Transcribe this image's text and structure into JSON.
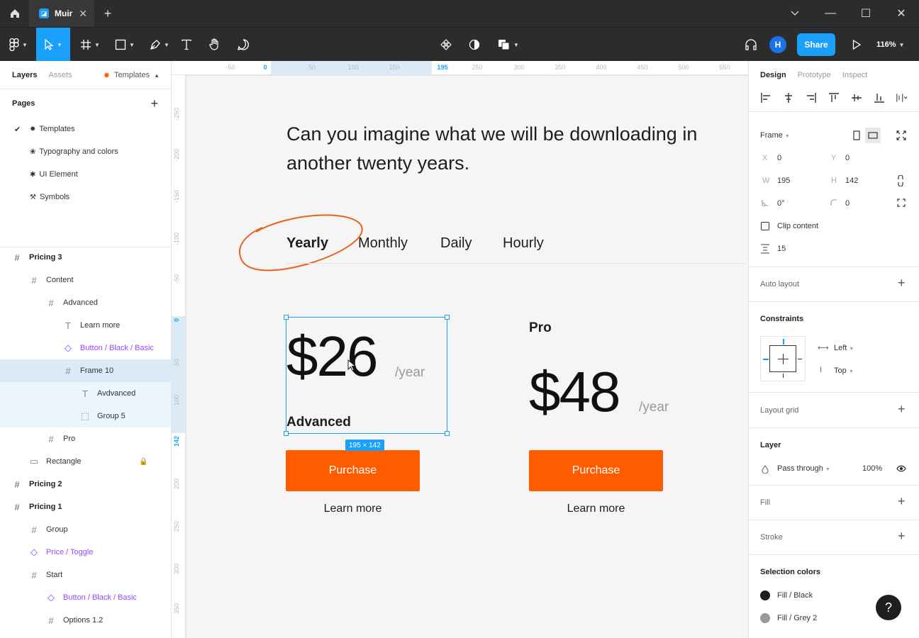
{
  "window": {
    "tab_name": "Muir",
    "minimize": "—",
    "maximize": "☐",
    "close": "✕"
  },
  "toolbar": {
    "avatar_initial": "H",
    "share_label": "Share",
    "zoom_label": "116%"
  },
  "left_panel": {
    "tabs": [
      "Layers",
      "Assets"
    ],
    "templates_label": "Templates",
    "pages_title": "Pages",
    "pages": [
      {
        "label": "Templates",
        "emoji": "✸",
        "current": true
      },
      {
        "label": "Typography and colors",
        "emoji": "❀",
        "current": false
      },
      {
        "label": "UI Element",
        "emoji": "✱",
        "current": false
      },
      {
        "label": "Symbols",
        "emoji": "⚒",
        "current": false
      }
    ],
    "layers": [
      {
        "label": "Pricing 3",
        "indent": 0,
        "type": "frame",
        "bold": true
      },
      {
        "label": "Content",
        "indent": 1,
        "type": "frame"
      },
      {
        "label": "Advanced",
        "indent": 2,
        "type": "frame"
      },
      {
        "label": "Learn more",
        "indent": 3,
        "type": "text"
      },
      {
        "label": "Button / Black / Basic",
        "indent": 3,
        "type": "component"
      },
      {
        "label": "Frame 10",
        "indent": 3,
        "type": "frame",
        "selected": true
      },
      {
        "label": "Avdvanced",
        "indent": 4,
        "type": "text",
        "subselected": true
      },
      {
        "label": "Group 5",
        "indent": 4,
        "type": "group",
        "subselected": true
      },
      {
        "label": "Pro",
        "indent": 2,
        "type": "frame"
      },
      {
        "label": "Rectangle",
        "indent": 1,
        "type": "rect",
        "locked": true
      },
      {
        "label": "Pricing 2",
        "indent": 0,
        "type": "frame",
        "bold": true
      },
      {
        "label": "Pricing 1",
        "indent": 0,
        "type": "frame",
        "bold": true
      },
      {
        "label": "Group",
        "indent": 1,
        "type": "frame"
      },
      {
        "label": "Price / Toggle",
        "indent": 1,
        "type": "component"
      },
      {
        "label": "Start",
        "indent": 1,
        "type": "frame"
      },
      {
        "label": "Button / Black / Basic",
        "indent": 2,
        "type": "component"
      },
      {
        "label": "Options 1.2",
        "indent": 2,
        "type": "frame"
      }
    ]
  },
  "rulers": {
    "top": [
      "-50",
      "0",
      "50",
      "100",
      "150",
      "195",
      "250",
      "300",
      "350",
      "400",
      "450",
      "500",
      "550"
    ],
    "left": [
      "-250",
      "-200",
      "-150",
      "-100",
      "-50",
      "0",
      "50",
      "100",
      "142",
      "200",
      "250",
      "300",
      "350"
    ]
  },
  "canvas": {
    "headline": "Can you imagine what we will be downloading in another twenty years.",
    "period_tabs": [
      "Yearly",
      "Monthly",
      "Daily",
      "Hourly"
    ],
    "cards": [
      {
        "plan": "Advanced",
        "price": "$26",
        "per": "/year",
        "button": "Purchase",
        "link": "Learn more"
      },
      {
        "plan": "Pro",
        "price": "$48",
        "per": "/year",
        "button": "Purchase",
        "link": "Learn more"
      }
    ],
    "selection_size": "195 × 142",
    "accent": "#ff5c00",
    "selection_color": "#18a0fb"
  },
  "right_panel": {
    "tabs": [
      "Design",
      "Prototype",
      "Inspect"
    ],
    "frame_label": "Frame",
    "x_label": "X",
    "x_value": "0",
    "y_label": "Y",
    "y_value": "0",
    "w_label": "W",
    "w_value": "195",
    "h_label": "H",
    "h_value": "142",
    "rotation": "0°",
    "radius": "0",
    "clip_content": "Clip content",
    "spacing": "15",
    "auto_layout": "Auto layout",
    "constraints": "Constraints",
    "constraint_h": "Left",
    "constraint_v": "Top",
    "layout_grid": "Layout grid",
    "layer": "Layer",
    "blend": "Pass through",
    "opacity": "100%",
    "fill": "Fill",
    "stroke": "Stroke",
    "selection_colors": "Selection colors",
    "colors": [
      {
        "label": "Fill / Black",
        "hex": "#1e1e1e"
      },
      {
        "label": "Fill / Grey 2",
        "hex": "#9a9a9a"
      }
    ],
    "help": "?"
  }
}
